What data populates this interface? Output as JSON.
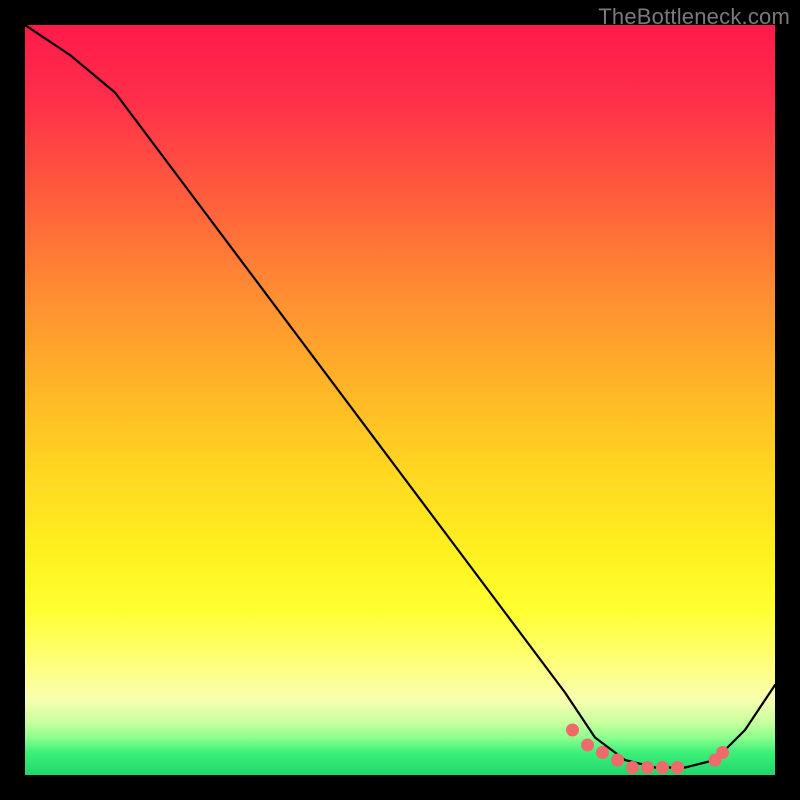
{
  "watermark": "TheBottleneck.com",
  "chart_data": {
    "type": "line",
    "title": "",
    "xlabel": "",
    "ylabel": "",
    "xlim": [
      0,
      100
    ],
    "ylim": [
      0,
      100
    ],
    "grid": false,
    "legend": false,
    "series": [
      {
        "name": "bottleneck-curve",
        "x": [
          0,
          6,
          12,
          18,
          24,
          30,
          36,
          42,
          48,
          54,
          60,
          66,
          72,
          76,
          80,
          84,
          88,
          92,
          96,
          100
        ],
        "y": [
          100,
          96,
          91,
          83,
          75,
          67,
          59,
          51,
          43,
          35,
          27,
          19,
          11,
          5,
          2,
          1,
          1,
          2,
          6,
          12
        ]
      }
    ],
    "markers": {
      "name": "highlight-range",
      "x": [
        73,
        75,
        77,
        79,
        81,
        83,
        85,
        87,
        92,
        93
      ],
      "y": [
        6,
        4,
        3,
        2,
        1,
        1,
        1,
        1,
        2,
        3
      ]
    },
    "background_meaning": "vertical red-yellow-green gradient; green band (y≈0–3) = optimal"
  }
}
